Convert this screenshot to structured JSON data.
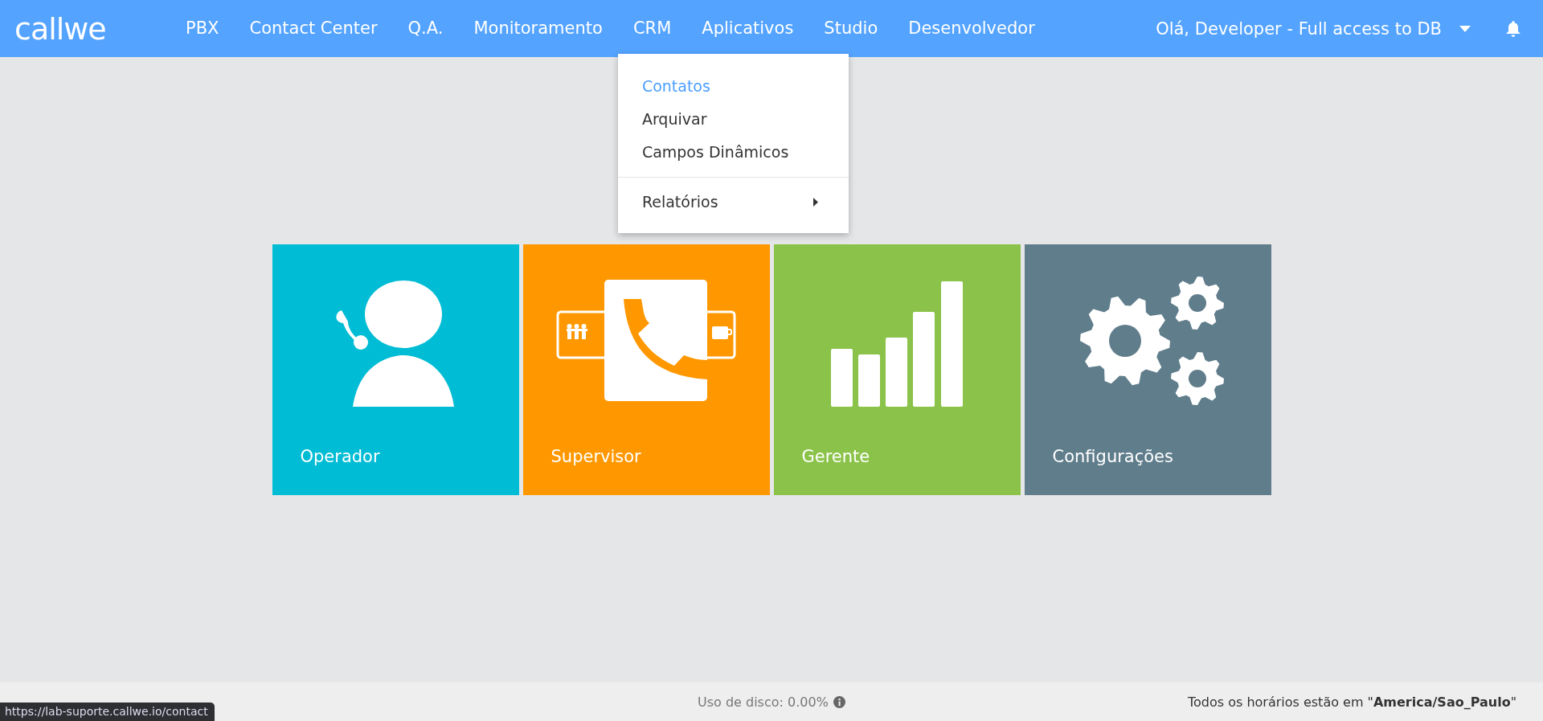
{
  "header": {
    "logo": "callwe",
    "nav": [
      {
        "label": "PBX",
        "open": false
      },
      {
        "label": "Contact Center",
        "open": false
      },
      {
        "label": "Q.A.",
        "open": false
      },
      {
        "label": "Monitoramento",
        "open": false
      },
      {
        "label": "CRM",
        "open": true
      },
      {
        "label": "Aplicativos",
        "open": false
      },
      {
        "label": "Studio",
        "open": false
      },
      {
        "label": "Desenvolvedor",
        "open": false
      }
    ],
    "user": "Olá, Developer - Full access to DB"
  },
  "crm_menu": {
    "items": [
      {
        "label": "Contatos",
        "kind": "link",
        "selected": true
      },
      {
        "label": "Arquivar",
        "kind": "link",
        "selected": false
      },
      {
        "label": "Campos Dinâmicos",
        "kind": "link",
        "selected": false
      },
      {
        "label": "Relatórios",
        "kind": "submenu",
        "selected": false
      }
    ]
  },
  "tiles": [
    {
      "label": "Operador",
      "kind": "operator",
      "color": "#00bcd4"
    },
    {
      "label": "Supervisor",
      "kind": "supervisor",
      "color": "#ff9800"
    },
    {
      "label": "Gerente",
      "kind": "manager",
      "color": "#8bc34a"
    },
    {
      "label": "Configurações",
      "kind": "settings",
      "color": "#607d8b"
    }
  ],
  "footer": {
    "disk_usage": "Uso de disco: 0.00%",
    "timezone": "Todos os horários estão em \"**America/Sao_Paulo**\""
  },
  "status_url": "https://lab-suporte.callwe.io/contact"
}
